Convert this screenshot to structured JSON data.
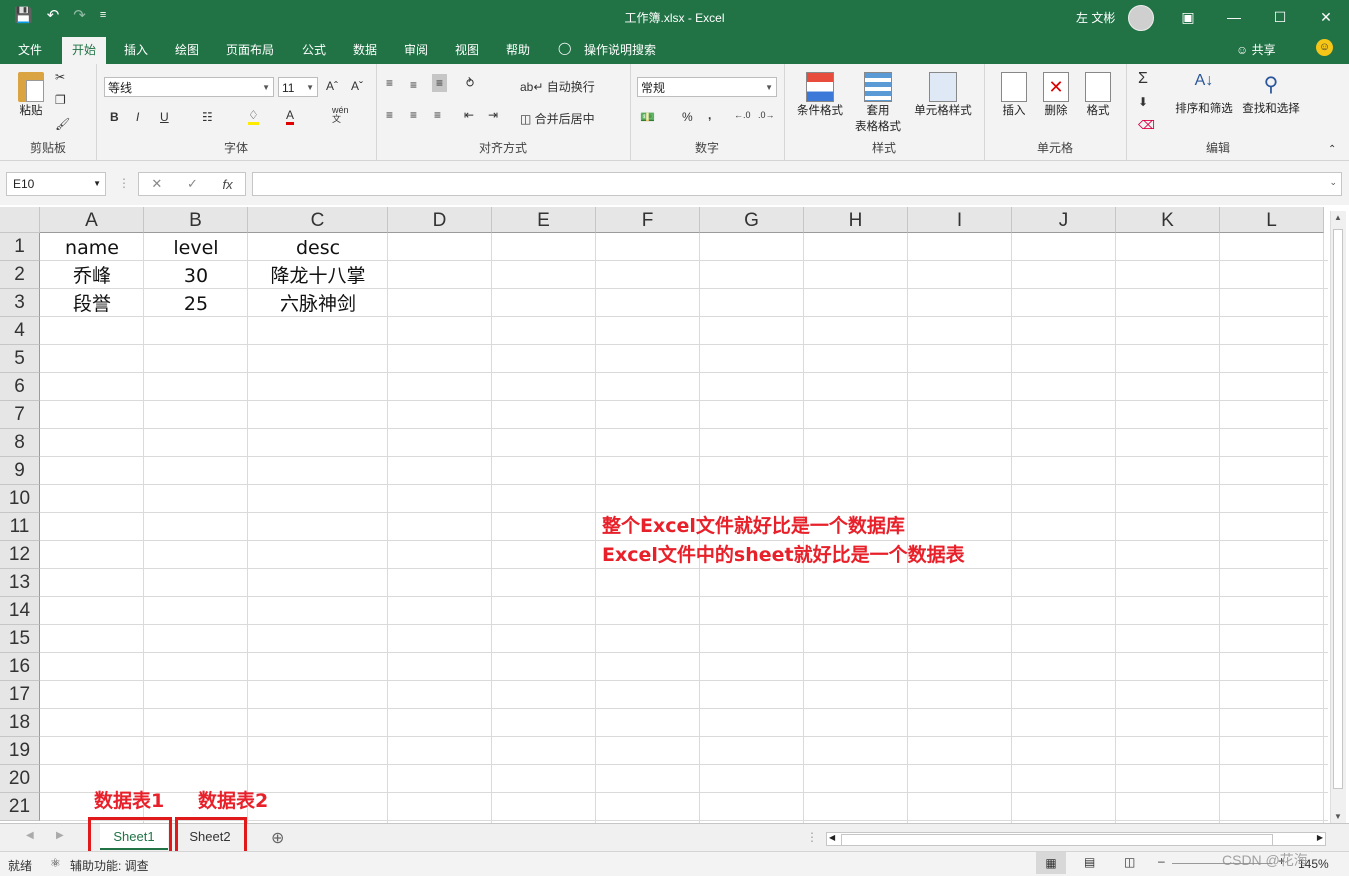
{
  "titlebar": {
    "title": "工作簿.xlsx  -  Excel",
    "user": "左 文彬",
    "qat": [
      "save-icon",
      "undo-icon",
      "redo-icon",
      "customize-icon"
    ]
  },
  "tabs": [
    "文件",
    "开始",
    "插入",
    "绘图",
    "页面布局",
    "公式",
    "数据",
    "审阅",
    "视图",
    "帮助",
    "操作说明搜索"
  ],
  "share": "共享",
  "ribbon": {
    "clipboard": {
      "paste": "粘贴",
      "label": "剪贴板"
    },
    "font": {
      "name": "等线",
      "size": "11",
      "label": "字体",
      "bold": "B",
      "italic": "I",
      "underline": "U",
      "phonetic": "wén\n文"
    },
    "alignment": {
      "wrap": "自动换行",
      "merge": "合并后居中",
      "label": "对齐方式"
    },
    "number": {
      "format": "常规",
      "label": "数字",
      "percent": "%",
      "comma": ","
    },
    "styles": {
      "cond": "条件格式",
      "table1": "套用",
      "table2": "表格格式",
      "cell": "单元格样式",
      "label": "样式"
    },
    "cells": {
      "insert": "插入",
      "delete": "删除",
      "format": "格式",
      "label": "单元格"
    },
    "editing": {
      "sort": "排序和筛选",
      "find": "查找和选择",
      "label": "编辑"
    }
  },
  "namebox": "E10",
  "fx": "fx",
  "columns": [
    "A",
    "B",
    "C",
    "D",
    "E",
    "F",
    "G",
    "H",
    "I",
    "J",
    "K",
    "L"
  ],
  "rows": [
    "1",
    "2",
    "3",
    "4",
    "5",
    "6",
    "7",
    "8",
    "9",
    "10",
    "11",
    "12",
    "13",
    "14",
    "15",
    "16",
    "17",
    "18",
    "19",
    "20",
    "21"
  ],
  "cells": [
    [
      "name",
      "level",
      "desc"
    ],
    [
      "乔峰",
      "30",
      "降龙十八掌"
    ],
    [
      "段誉",
      "25",
      "六脉神剑"
    ]
  ],
  "annotations": {
    "line1": "整个Excel文件就好比是一个数据库",
    "line2": "Excel文件中的sheet就好比是一个数据表",
    "sheet1_label": "数据表1",
    "sheet2_label": "数据表2"
  },
  "sheets": [
    "Sheet1",
    "Sheet2"
  ],
  "status": {
    "ready": "就绪",
    "accessibility": "辅助功能: 调查",
    "zoom": "145%",
    "watermark": "CSDN @花海"
  }
}
